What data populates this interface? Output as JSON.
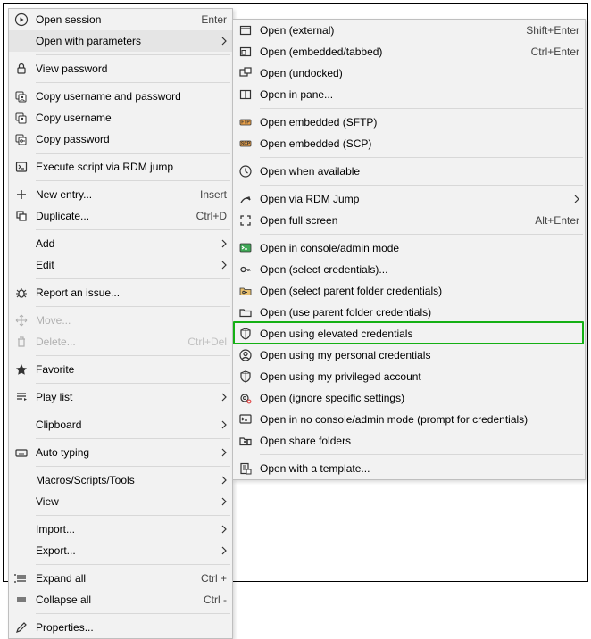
{
  "left_menu": {
    "items": [
      {
        "label": "Open session",
        "shortcut": "Enter",
        "icon": "play-circle",
        "sep_after": false
      },
      {
        "label": "Open with parameters",
        "shortcut": "",
        "icon": "",
        "submenu": true,
        "hover": true,
        "sep_after": true
      },
      {
        "label": "View password",
        "shortcut": "",
        "icon": "lock",
        "sep_after": true
      },
      {
        "label": "Copy username and password",
        "shortcut": "",
        "icon": "copy-users",
        "sep_after": false
      },
      {
        "label": "Copy username",
        "shortcut": "",
        "icon": "copy-user",
        "sep_after": false
      },
      {
        "label": "Copy password",
        "shortcut": "",
        "icon": "copy-key",
        "sep_after": true
      },
      {
        "label": "Execute script via RDM jump",
        "shortcut": "",
        "icon": "script",
        "sep_after": true
      },
      {
        "label": "New entry...",
        "shortcut": "Insert",
        "icon": "plus",
        "sep_after": false
      },
      {
        "label": "Duplicate...",
        "shortcut": "Ctrl+D",
        "icon": "duplicate",
        "sep_after": true
      },
      {
        "label": "Add",
        "shortcut": "",
        "icon": "",
        "submenu": true,
        "sep_after": false
      },
      {
        "label": "Edit",
        "shortcut": "",
        "icon": "",
        "submenu": true,
        "sep_after": true
      },
      {
        "label": "Report an issue...",
        "shortcut": "",
        "icon": "bug",
        "sep_after": true
      },
      {
        "label": "Move...",
        "shortcut": "",
        "icon": "move",
        "disabled": true,
        "sep_after": false
      },
      {
        "label": "Delete...",
        "shortcut": "Ctrl+Del",
        "icon": "trash",
        "disabled": true,
        "sep_after": true
      },
      {
        "label": "Favorite",
        "shortcut": "",
        "icon": "star",
        "sep_after": true
      },
      {
        "label": "Play list",
        "shortcut": "",
        "icon": "playlist",
        "submenu": true,
        "sep_after": true
      },
      {
        "label": "Clipboard",
        "shortcut": "",
        "icon": "",
        "submenu": true,
        "sep_after": true
      },
      {
        "label": "Auto typing",
        "shortcut": "",
        "icon": "keyboard",
        "submenu": true,
        "sep_after": true
      },
      {
        "label": "Macros/Scripts/Tools",
        "shortcut": "",
        "icon": "",
        "submenu": true,
        "sep_after": false
      },
      {
        "label": "View",
        "shortcut": "",
        "icon": "",
        "submenu": true,
        "sep_after": true
      },
      {
        "label": "Import...",
        "shortcut": "",
        "icon": "",
        "submenu": true,
        "sep_after": false
      },
      {
        "label": "Export...",
        "shortcut": "",
        "icon": "",
        "submenu": true,
        "sep_after": true
      },
      {
        "label": "Expand all",
        "shortcut": "Ctrl +",
        "icon": "expand",
        "sep_after": false
      },
      {
        "label": "Collapse all",
        "shortcut": "Ctrl -",
        "icon": "collapse",
        "sep_after": true
      },
      {
        "label": "Properties...",
        "shortcut": "",
        "icon": "pencil",
        "sep_after": false
      }
    ]
  },
  "right_menu": {
    "items": [
      {
        "label": "Open (external)",
        "shortcut": "Shift+Enter",
        "icon": "window-ext",
        "sep_after": false
      },
      {
        "label": "Open (embedded/tabbed)",
        "shortcut": "Ctrl+Enter",
        "icon": "window-emb",
        "sep_after": false
      },
      {
        "label": "Open (undocked)",
        "shortcut": "",
        "icon": "window-undock",
        "sep_after": false
      },
      {
        "label": "Open in pane...",
        "shortcut": "",
        "icon": "window-pane",
        "sep_after": true
      },
      {
        "label": "Open embedded (SFTP)",
        "shortcut": "",
        "icon": "sftp",
        "sep_after": false
      },
      {
        "label": "Open embedded (SCP)",
        "shortcut": "",
        "icon": "scp",
        "sep_after": true
      },
      {
        "label": "Open when available",
        "shortcut": "",
        "icon": "clock",
        "sep_after": true
      },
      {
        "label": "Open via RDM Jump",
        "shortcut": "",
        "icon": "jump",
        "submenu": true,
        "sep_after": false
      },
      {
        "label": "Open full screen",
        "shortcut": "Alt+Enter",
        "icon": "fullscreen",
        "sep_after": true
      },
      {
        "label": "Open in console/admin mode",
        "shortcut": "",
        "icon": "console",
        "sep_after": false
      },
      {
        "label": "Open (select credentials)...",
        "shortcut": "",
        "icon": "key",
        "sep_after": false
      },
      {
        "label": "Open (select parent folder credentials)",
        "shortcut": "",
        "icon": "folder-key",
        "sep_after": false
      },
      {
        "label": "Open (use parent folder credentials)",
        "shortcut": "",
        "icon": "folder-open",
        "sep_after": false
      },
      {
        "label": "Open using elevated credentials",
        "shortcut": "",
        "icon": "shield",
        "sep_after": false,
        "highlight": true
      },
      {
        "label": "Open using my personal credentials",
        "shortcut": "",
        "icon": "user-circle",
        "sep_after": false
      },
      {
        "label": "Open using my privileged account",
        "shortcut": "",
        "icon": "shield",
        "sep_after": false
      },
      {
        "label": "Open (ignore specific settings)",
        "shortcut": "",
        "icon": "gear-x",
        "sep_after": false
      },
      {
        "label": "Open in no console/admin mode (prompt for credentials)",
        "shortcut": "",
        "icon": "console-no",
        "sep_after": false
      },
      {
        "label": "Open share folders",
        "shortcut": "",
        "icon": "share-folder",
        "sep_after": true
      },
      {
        "label": "Open with a template...",
        "shortcut": "",
        "icon": "template",
        "sep_after": false
      }
    ]
  }
}
